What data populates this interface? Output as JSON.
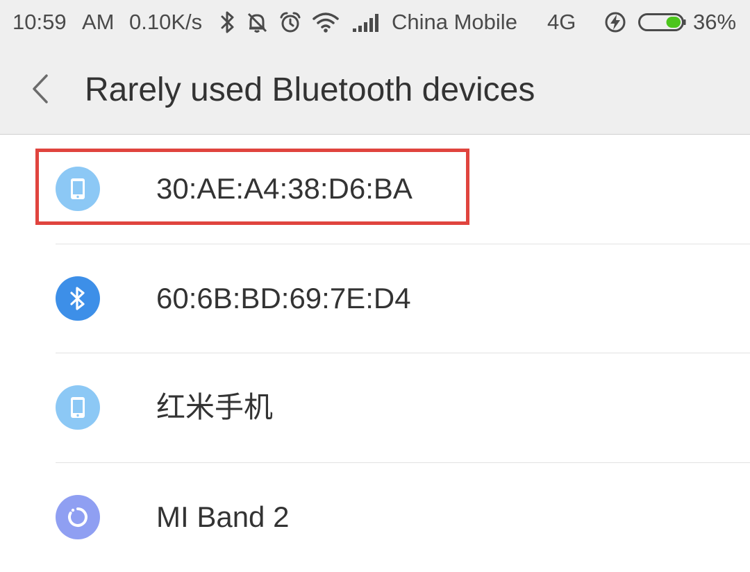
{
  "status_bar": {
    "time": "10:59",
    "ampm": "AM",
    "speed": "0.10K/s",
    "carrier": "China Mobile",
    "network": "4G",
    "battery_percent": "36%",
    "battery_level": 0.36,
    "icons": [
      "bluetooth-icon",
      "mute-bell-icon",
      "alarm-icon",
      "wifi-icon",
      "signal-icon",
      "charging-icon",
      "battery-icon"
    ]
  },
  "header": {
    "back_icon": "chevron-left-icon",
    "title": "Rarely used Bluetooth devices"
  },
  "devices": [
    {
      "name": "30:AE:A4:38:D6:BA",
      "icon": "phone-icon",
      "color": "#8cc8f5",
      "highlighted": true
    },
    {
      "name": "60:6B:BD:69:7E:D4",
      "icon": "bluetooth-icon",
      "color": "#3d8fe8"
    },
    {
      "name": "红米手机",
      "icon": "phone-icon",
      "color": "#8cc8f5"
    },
    {
      "name": "MI Band 2",
      "icon": "band-icon",
      "color": "#8f9ff2"
    }
  ],
  "colors": {
    "highlight_border": "#e0443e",
    "battery_fill": "#4cc51c"
  }
}
